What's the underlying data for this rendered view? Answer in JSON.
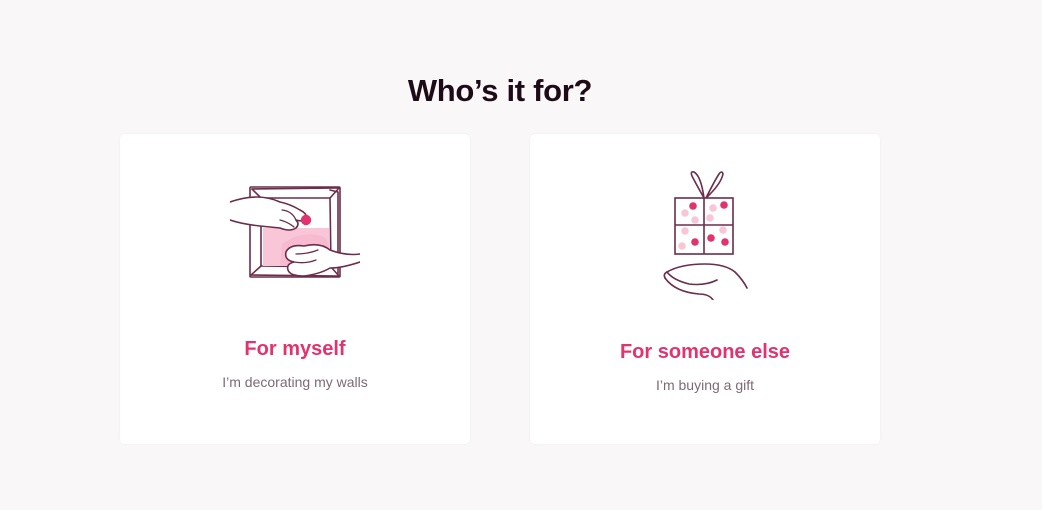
{
  "page": {
    "title": "Who’s it for?"
  },
  "options": [
    {
      "title": "For myself",
      "subtitle": "I’m decorating my walls",
      "icon": "framed-picture-in-hands-icon"
    },
    {
      "title": "For someone else",
      "subtitle": "I’m buying a gift",
      "icon": "gift-box-on-hand-icon"
    }
  ],
  "colors": {
    "background": "#faf7f8",
    "heading": "#1e0b18",
    "accent": "#e2336f",
    "subtitle": "#7d6a74",
    "line_art": "#6b2d4a",
    "light_pink": "#f9c6d8"
  }
}
